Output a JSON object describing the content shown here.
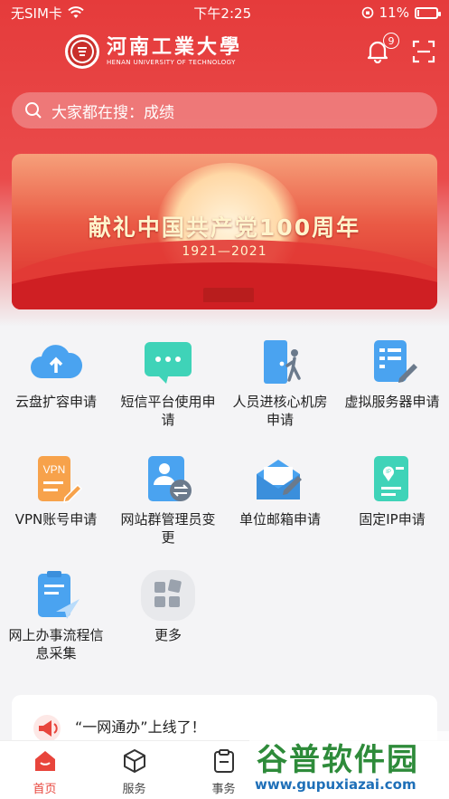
{
  "status_bar": {
    "carrier": "无SIM卡",
    "time": "下午2:25",
    "battery_percent": "11%",
    "battery_level": 0.11
  },
  "header": {
    "school_name_cn": "河南工業大學",
    "school_name_en": "HENAN UNIVERSITY OF TECHNOLOGY",
    "notification_count": "9"
  },
  "search": {
    "placeholder": "大家都在搜：成绩"
  },
  "banner": {
    "title": "献礼中国共产党100周年",
    "years": "1921—2021"
  },
  "apps": [
    {
      "label": "云盘扩容申请",
      "icon": "cloud-upload-icon",
      "color": "#4aa3f0"
    },
    {
      "label": "短信平台使用申请",
      "icon": "sms-bubble-icon",
      "color": "#3fd3b8"
    },
    {
      "label": "人员进核心机房申请",
      "icon": "door-person-icon",
      "color": "#4aa3f0"
    },
    {
      "label": "虚拟服务器申请",
      "icon": "document-edit-icon",
      "color": "#4aa3f0"
    },
    {
      "label": "VPN账号申请",
      "icon": "vpn-document-icon",
      "color": "#f7a24b"
    },
    {
      "label": "网站群管理员变更",
      "icon": "admin-swap-icon",
      "color": "#4aa3f0"
    },
    {
      "label": "单位邮箱申请",
      "icon": "mail-edit-icon",
      "color": "#4aa3f0"
    },
    {
      "label": "固定IP申请",
      "icon": "ip-document-icon",
      "color": "#3fd3b8"
    },
    {
      "label": "网上办事流程信息采集",
      "icon": "clipboard-plane-icon",
      "color": "#4aa3f0"
    },
    {
      "label": "更多",
      "icon": "more-grid-icon",
      "color": "#9aa2ad"
    }
  ],
  "notice": {
    "text": "“一网通办”上线了！",
    "icon": "megaphone-icon"
  },
  "tabs": [
    {
      "label": "首页",
      "icon": "home-icon",
      "active": true
    },
    {
      "label": "服务",
      "icon": "cube-icon",
      "active": false
    },
    {
      "label": "事务",
      "icon": "clipboard-icon",
      "active": false
    }
  ],
  "watermark": {
    "cn": "谷普软件园",
    "en": "www.gupuxiazai.com"
  },
  "colors": {
    "brand_red": "#e53b3b",
    "active_tab": "#e8453c"
  }
}
